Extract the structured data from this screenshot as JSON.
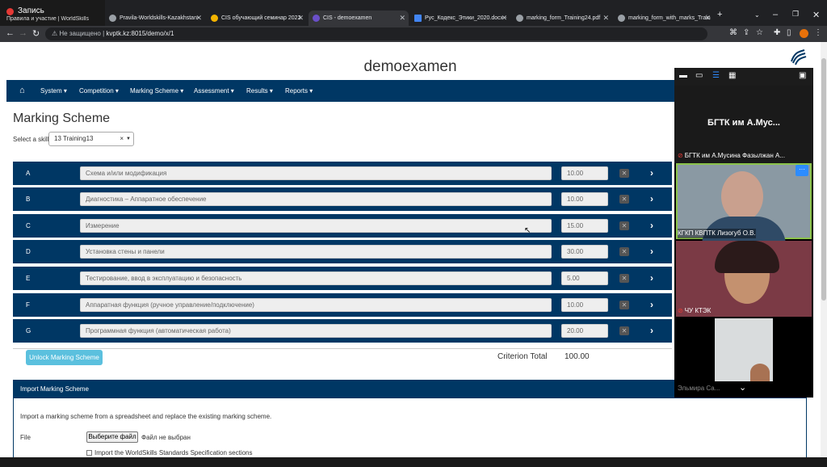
{
  "recording": {
    "label": "Запись",
    "sub": "Правила и участие | WorldSkills"
  },
  "tabs": [
    {
      "label": "Pravila-Worldskills-Kazakhstan-"
    },
    {
      "label": "CIS обучающий семинар 2022"
    },
    {
      "label": "CIS - demoexamen"
    },
    {
      "label": "Рус_Кодекс_Этики_2020.docx -"
    },
    {
      "label": "marking_form_Training24.pdf"
    },
    {
      "label": "marking_form_with_marks_Train"
    }
  ],
  "address": {
    "security": "Не защищено",
    "url": "kvptk.kz:8015/demo/x/1"
  },
  "site": {
    "title": "demoexamen"
  },
  "nav": {
    "system": "System ▾",
    "competition": "Competition ▾",
    "marking_scheme": "Marking Scheme ▾",
    "assessment": "Assessment ▾",
    "results": "Results ▾",
    "reports": "Reports ▾"
  },
  "main": {
    "heading": "Marking Scheme",
    "skill_label": "Select a skill",
    "skill_value": "13 Training13",
    "criteria": [
      {
        "letter": "A",
        "name": "Схема и/или модификация",
        "mark": "10.00"
      },
      {
        "letter": "B",
        "name": "Диагностика – Аппаратное обеспечение",
        "mark": "10.00"
      },
      {
        "letter": "C",
        "name": "Измерение",
        "mark": "15.00"
      },
      {
        "letter": "D",
        "name": "Установка стены и панели",
        "mark": "30.00"
      },
      {
        "letter": "E",
        "name": "Тестирование, ввод в эксплуатацию и безопасность",
        "mark": "5.00"
      },
      {
        "letter": "F",
        "name": "Аппаратная функция (ручное управление/подключение)",
        "mark": "10.00"
      },
      {
        "letter": "G",
        "name": "Программная функция (автоматическая работа)",
        "mark": "20.00"
      }
    ],
    "unlock_label": "Unlock Marking Scheme",
    "criterion_total_label": "Criterion Total",
    "criterion_total_value": "100.00"
  },
  "import": {
    "header": "Import Marking Scheme",
    "description": "Import a marking scheme from a spreadsheet and replace the existing marking scheme.",
    "file_label": "File",
    "file_button": "Выберите файл",
    "file_none": "Файл не выбран",
    "checkbox_label": "Import the WorldSkills Standards Specification sections"
  },
  "zoom": {
    "header_name": "БГТК им А.Мус...",
    "participant1": "БГТК им А.Мусина Фазылжан А...",
    "participant2": "КГКП КВПТК Лизогуб О.В.",
    "participant3": "ЧУ КТЭК",
    "participant4": "Эльмира Са..."
  },
  "colors": {
    "nav": "#003764",
    "accent": "#5bc0de",
    "zoom_bg": "#000000"
  }
}
